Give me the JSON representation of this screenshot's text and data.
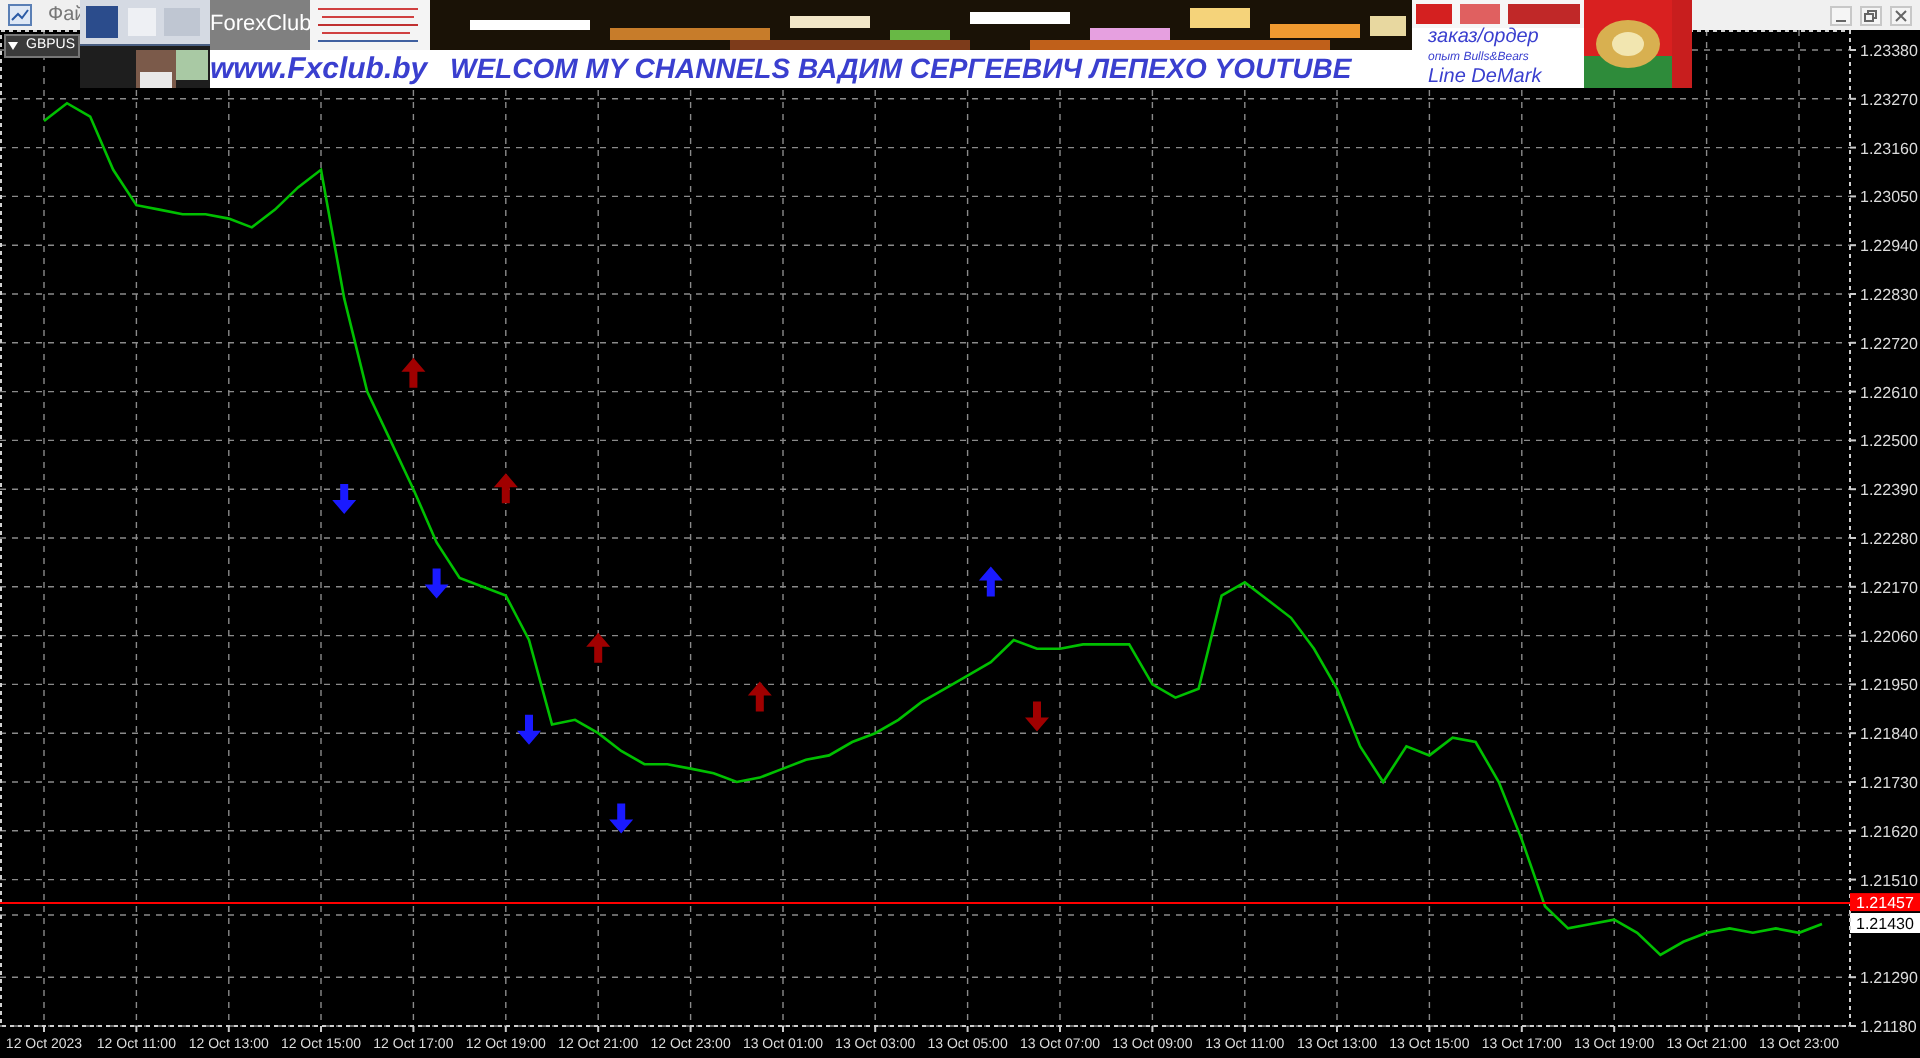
{
  "window": {
    "menu_item": "Фай"
  },
  "banner": {
    "site_name": "ForexClub",
    "url": "www.Fxclub.by",
    "headline": "WELCOM MY CHANNELS ВАДИМ СЕРГЕЕВИЧ ЛЕПЕХО YOUTUBE",
    "side_lines": [
      "заказ/ордер",
      "опыт Bulls&Bears",
      "Line DeMark"
    ]
  },
  "chart": {
    "symbol": "GBPUS",
    "chart_data": {
      "type": "line",
      "grid": true,
      "ylim": [
        1.2118,
        1.23425
      ],
      "categories": [
        "12 Oct 2023",
        null,
        null,
        null,
        "12 Oct 11:00",
        null,
        null,
        null,
        "12 Oct 13:00",
        null,
        null,
        null,
        "12 Oct 15:00",
        null,
        null,
        null,
        "12 Oct 17:00",
        null,
        null,
        null,
        "12 Oct 19:00",
        null,
        null,
        null,
        "12 Oct 21:00",
        null,
        null,
        null,
        "12 Oct 23:00",
        null,
        null,
        null,
        "13 Oct 01:00",
        null,
        null,
        null,
        "13 Oct 03:00",
        null,
        null,
        null,
        "13 Oct 05:00",
        null,
        null,
        null,
        "13 Oct 07:00",
        null,
        null,
        null,
        "13 Oct 09:00",
        null,
        null,
        null,
        "13 Oct 11:00",
        null,
        null,
        null,
        "13 Oct 13:00",
        null,
        null,
        null,
        "13 Oct 15:00",
        null,
        null,
        null,
        "13 Oct 17:00",
        null,
        null,
        null,
        "13 Oct 19:00",
        null,
        null,
        null,
        "13 Oct 21:00",
        null,
        null,
        null,
        "13 Oct 23:00",
        null
      ],
      "series": [
        {
          "color": "#00c000",
          "values": [
            1.2322,
            1.2326,
            1.2323,
            1.2311,
            1.2303,
            1.2302,
            1.2301,
            1.2301,
            1.23,
            1.2298,
            1.2302,
            1.2307,
            1.2311,
            1.2282,
            1.2261,
            1.225,
            1.2239,
            1.2227,
            1.2219,
            1.2217,
            1.2215,
            1.2205,
            1.2186,
            1.2187,
            1.2184,
            1.218,
            1.2177,
            1.2177,
            1.2176,
            1.2175,
            1.2173,
            1.2174,
            1.2176,
            1.2178,
            1.2179,
            1.2182,
            1.2184,
            1.2187,
            1.2191,
            1.2194,
            1.2197,
            1.22,
            1.2205,
            1.2203,
            1.2203,
            1.2204,
            1.2204,
            1.2204,
            1.2195,
            1.2192,
            1.2194,
            1.2215,
            1.2218,
            1.2214,
            1.221,
            1.2203,
            1.2194,
            1.2181,
            1.2173,
            1.2181,
            1.2179,
            1.2183,
            1.2182,
            1.2173,
            1.216,
            1.2145,
            1.214,
            1.2141,
            1.2142,
            1.2139,
            1.2134,
            1.2137,
            1.2139,
            1.214,
            1.2139,
            1.214,
            1.2139,
            1.2141
          ]
        },
        {
          "type": "scatter",
          "color": "#1a1aff",
          "values": [
            null,
            null,
            null,
            null,
            null,
            null,
            null,
            null,
            null,
            null,
            null,
            null,
            null,
            1.2237,
            null,
            null,
            null,
            1.2218,
            null,
            null,
            null,
            1.2185,
            null,
            null,
            null,
            1.2165,
            null,
            null,
            null,
            null,
            null,
            null,
            null,
            null,
            null,
            null,
            null,
            null,
            null,
            null,
            null,
            1.2218,
            null,
            null,
            null,
            null,
            null,
            null,
            null,
            null,
            null,
            null,
            null,
            null,
            null,
            null,
            null,
            null,
            null,
            null,
            null,
            null,
            null,
            null,
            null,
            null,
            null,
            null,
            null,
            null,
            null,
            null,
            null,
            null,
            null,
            null,
            null,
            null
          ]
        },
        {
          "type": "scatter",
          "color": "#a00000",
          "values": [
            null,
            null,
            null,
            null,
            null,
            null,
            null,
            null,
            null,
            null,
            null,
            null,
            null,
            null,
            null,
            null,
            1.2265,
            null,
            null,
            null,
            1.2239,
            null,
            null,
            null,
            1.2203,
            null,
            null,
            null,
            null,
            null,
            null,
            1.2192,
            null,
            null,
            null,
            null,
            null,
            null,
            null,
            null,
            null,
            null,
            null,
            1.2188,
            null,
            null,
            null,
            null,
            null,
            null,
            null,
            null,
            null,
            null,
            null,
            null,
            null,
            null,
            null,
            null,
            null,
            null,
            null,
            null,
            null,
            null,
            null,
            null,
            null,
            null,
            null,
            null,
            null,
            null,
            null,
            null,
            null,
            null
          ]
        }
      ],
      "ref_lines": [
        {
          "axis": "y",
          "value": 1.21457,
          "label": "1.21457",
          "color": "#ff0000"
        }
      ],
      "yticks": [
        {
          "value": 1.2338,
          "label": "1.23380"
        },
        {
          "value": 1.2327,
          "label": "1.23270"
        },
        {
          "value": 1.2316,
          "label": "1.23160"
        },
        {
          "value": 1.2305,
          "label": "1.23050"
        },
        {
          "value": 1.2294,
          "label": "1.22940"
        },
        {
          "value": 1.2283,
          "label": "1.22830"
        },
        {
          "value": 1.2272,
          "label": "1.22720"
        },
        {
          "value": 1.2261,
          "label": "1.22610"
        },
        {
          "value": 1.225,
          "label": "1.22500"
        },
        {
          "value": 1.2239,
          "label": "1.22390"
        },
        {
          "value": 1.2228,
          "label": "1.22280"
        },
        {
          "value": 1.2217,
          "label": "1.22170"
        },
        {
          "value": 1.2206,
          "label": "1.22060"
        },
        {
          "value": 1.2195,
          "label": "1.21950"
        },
        {
          "value": 1.2184,
          "label": "1.21840"
        },
        {
          "value": 1.2173,
          "label": "1.21730"
        },
        {
          "value": 1.2162,
          "label": "1.21620"
        },
        {
          "value": 1.2151,
          "label": "1.21510"
        },
        {
          "value": 1.2143,
          "label": "1.21430"
        },
        {
          "value": 1.2129,
          "label": "1.21290"
        },
        {
          "value": 1.2118,
          "label": "1.21180"
        }
      ]
    }
  }
}
